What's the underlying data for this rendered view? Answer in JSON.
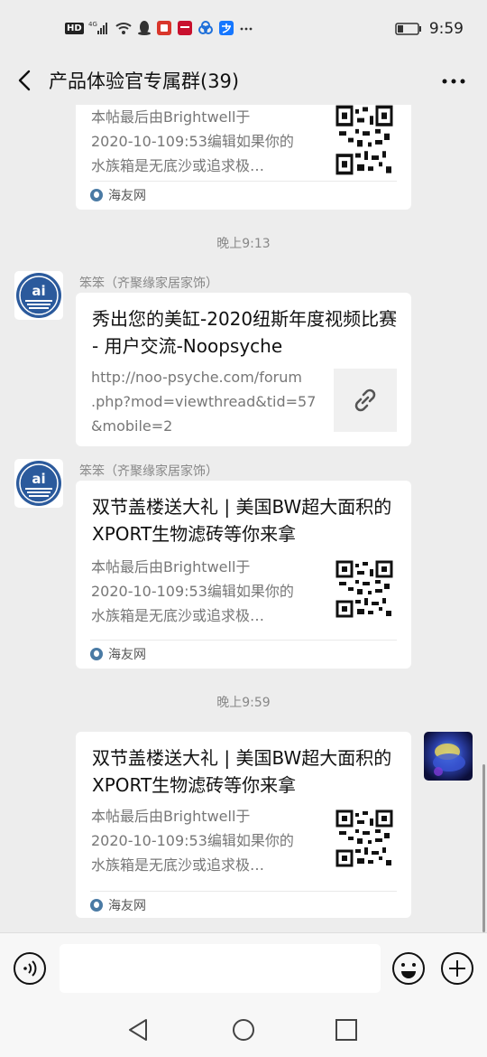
{
  "status_bar": {
    "hd": "HD",
    "network": "4G",
    "time": "9:59"
  },
  "nav": {
    "title": "产品体验官专属群(39)",
    "more": "···"
  },
  "messages": [
    {
      "type": "article",
      "title": "",
      "desc": [
        "本帖最后由Brightwell于",
        "2020-10-109:53编辑如果你的",
        "水族箱是无底沙或追求极…"
      ],
      "source": "海友网"
    },
    {
      "type": "time",
      "text": "晚上9:13"
    },
    {
      "type": "link",
      "sender": "笨笨（齐聚缘家居家饰）",
      "title": "秀出您的美缸-2020纽斯年度视频比赛 - 用户交流-Noopsyche",
      "url_lines": [
        "http://noo-psyche.com/forum",
        ".php?mod=viewthread&tid=57",
        "&mobile=2"
      ]
    },
    {
      "type": "article",
      "sender": "笨笨（齐聚缘家居家饰）",
      "title": "双节盖楼送大礼 | 美国BW超大面积的XPORT生物滤砖等你来拿",
      "desc": [
        "本帖最后由Brightwell于",
        "2020-10-109:53编辑如果你的",
        "水族箱是无底沙或追求极…"
      ],
      "source": "海友网"
    },
    {
      "type": "time",
      "text": "晚上9:59"
    },
    {
      "type": "article",
      "self": true,
      "title": "双节盖楼送大礼 | 美国BW超大面积的XPORT生物滤砖等你来拿",
      "desc": [
        "本帖最后由Brightwell于",
        "2020-10-109:53编辑如果你的",
        "水族箱是无底沙或追求极…"
      ],
      "source": "海友网"
    }
  ],
  "input": {
    "placeholder": "",
    "value": ""
  },
  "colors": {
    "background": "#ededed",
    "card": "#ffffff",
    "avatar_blue": "#2b5a9c"
  }
}
